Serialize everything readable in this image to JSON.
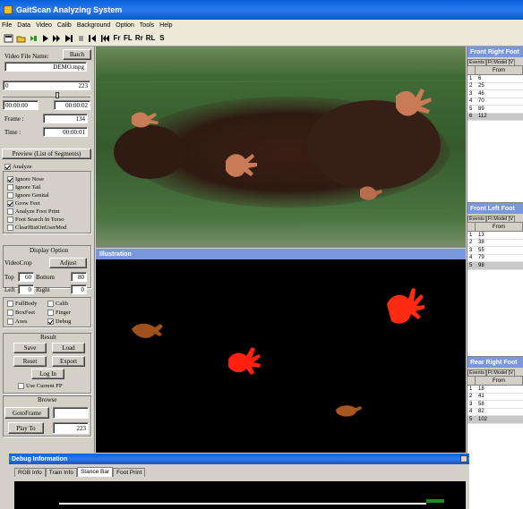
{
  "window": {
    "title": "GaitScan Analyzing System"
  },
  "menu": [
    "File",
    "Data",
    "Video",
    "Calib",
    "Background",
    "Option",
    "Tools",
    "Help"
  ],
  "toolbar": {
    "text_buttons": [
      "Fr",
      "FL",
      "Rr",
      "RL",
      "S"
    ]
  },
  "left_panel": {
    "video_file_label": "Video File Name:",
    "batch_label": "Batch",
    "file_name": "DEMO.mpg",
    "range_start": "0",
    "range_end": "223",
    "time_start": "00:00:00",
    "time_end": "00:00:02",
    "frame_label": "Frame :",
    "frame_value": "134",
    "time_label": "Time :",
    "time_value": "00:00:01",
    "preview_label": "Preview (List of Segments)",
    "analyze_label": "Analyze",
    "options": [
      {
        "label": "Ignore Nose",
        "checked": true
      },
      {
        "label": "Ignore Tail",
        "checked": false
      },
      {
        "label": "Ignore Genital",
        "checked": false
      },
      {
        "label": "Grow Feet",
        "checked": true
      },
      {
        "label": "Analyze Foot Print",
        "checked": false
      },
      {
        "label": "Foot Search In Torso",
        "checked": false
      },
      {
        "label": "ClearHistOnUserMod",
        "checked": false
      }
    ],
    "display_option_title": "Display Option",
    "videocrop_label": "VideoCrop",
    "adjust_label": "Adjust",
    "top_label": "Top",
    "top_value": "60",
    "bottom_label": "Bottom",
    "bottom_value": "80",
    "left_label": "Left",
    "left_value": "0",
    "right_label": "Right",
    "right_value": "0",
    "display_checks": [
      {
        "label": "FullBody",
        "checked": false
      },
      {
        "label": "Calib",
        "checked": false
      },
      {
        "label": "BoxFeet",
        "checked": false
      },
      {
        "label": "Finger",
        "checked": false
      },
      {
        "label": "Axes",
        "checked": false
      },
      {
        "label": "Debug",
        "checked": true
      }
    ],
    "result_title": "Result",
    "save_label": "Save",
    "load_label": "Load",
    "reset_label": "Reset",
    "export_label": "Export",
    "login_label": "Log In",
    "use_current_fp_label": "Use Current FP",
    "browse_title": "Browse",
    "goto_frame_label": "GotoFrame",
    "goto_frame_value": "",
    "play_to_label": "Play To",
    "play_to_value": "223"
  },
  "illustration": {
    "title": "Illustration"
  },
  "right_panels": [
    {
      "title": "Front Right Foot",
      "tabs": [
        "Events",
        "Ft Model [V"
      ],
      "col_from": "From",
      "rows": [
        [
          "1",
          "6"
        ],
        [
          "2",
          "25"
        ],
        [
          "3",
          "46"
        ],
        [
          "4",
          "70"
        ],
        [
          "5",
          "89"
        ],
        [
          "6",
          "112"
        ]
      ],
      "selected": 5
    },
    {
      "title": "Front Left Foot",
      "tabs": [
        "Events",
        "Ft Model [V"
      ],
      "col_from": "From",
      "rows": [
        [
          "1",
          "13"
        ],
        [
          "2",
          "38"
        ],
        [
          "3",
          "55"
        ],
        [
          "4",
          "79"
        ],
        [
          "5",
          "98"
        ]
      ],
      "selected": 4
    },
    {
      "title": "Rear Right Foot",
      "tabs": [
        "Events",
        "Ft Model [V"
      ],
      "col_from": "From",
      "rows": [
        [
          "1",
          "18"
        ],
        [
          "2",
          "41"
        ],
        [
          "3",
          "58"
        ],
        [
          "4",
          "82"
        ],
        [
          "5",
          "102"
        ]
      ],
      "selected": 4
    }
  ],
  "debug": {
    "title": "Debug Information",
    "tabs": [
      "RGB Info",
      "Train Info",
      "Stance Bar",
      "Foot Print"
    ],
    "active_tab": 2
  },
  "colors": {
    "title_blue": "#0a5fd8",
    "panel_header": "#7a96df",
    "paw_red": "#ff2010",
    "paw_brown": "#a0501c"
  }
}
